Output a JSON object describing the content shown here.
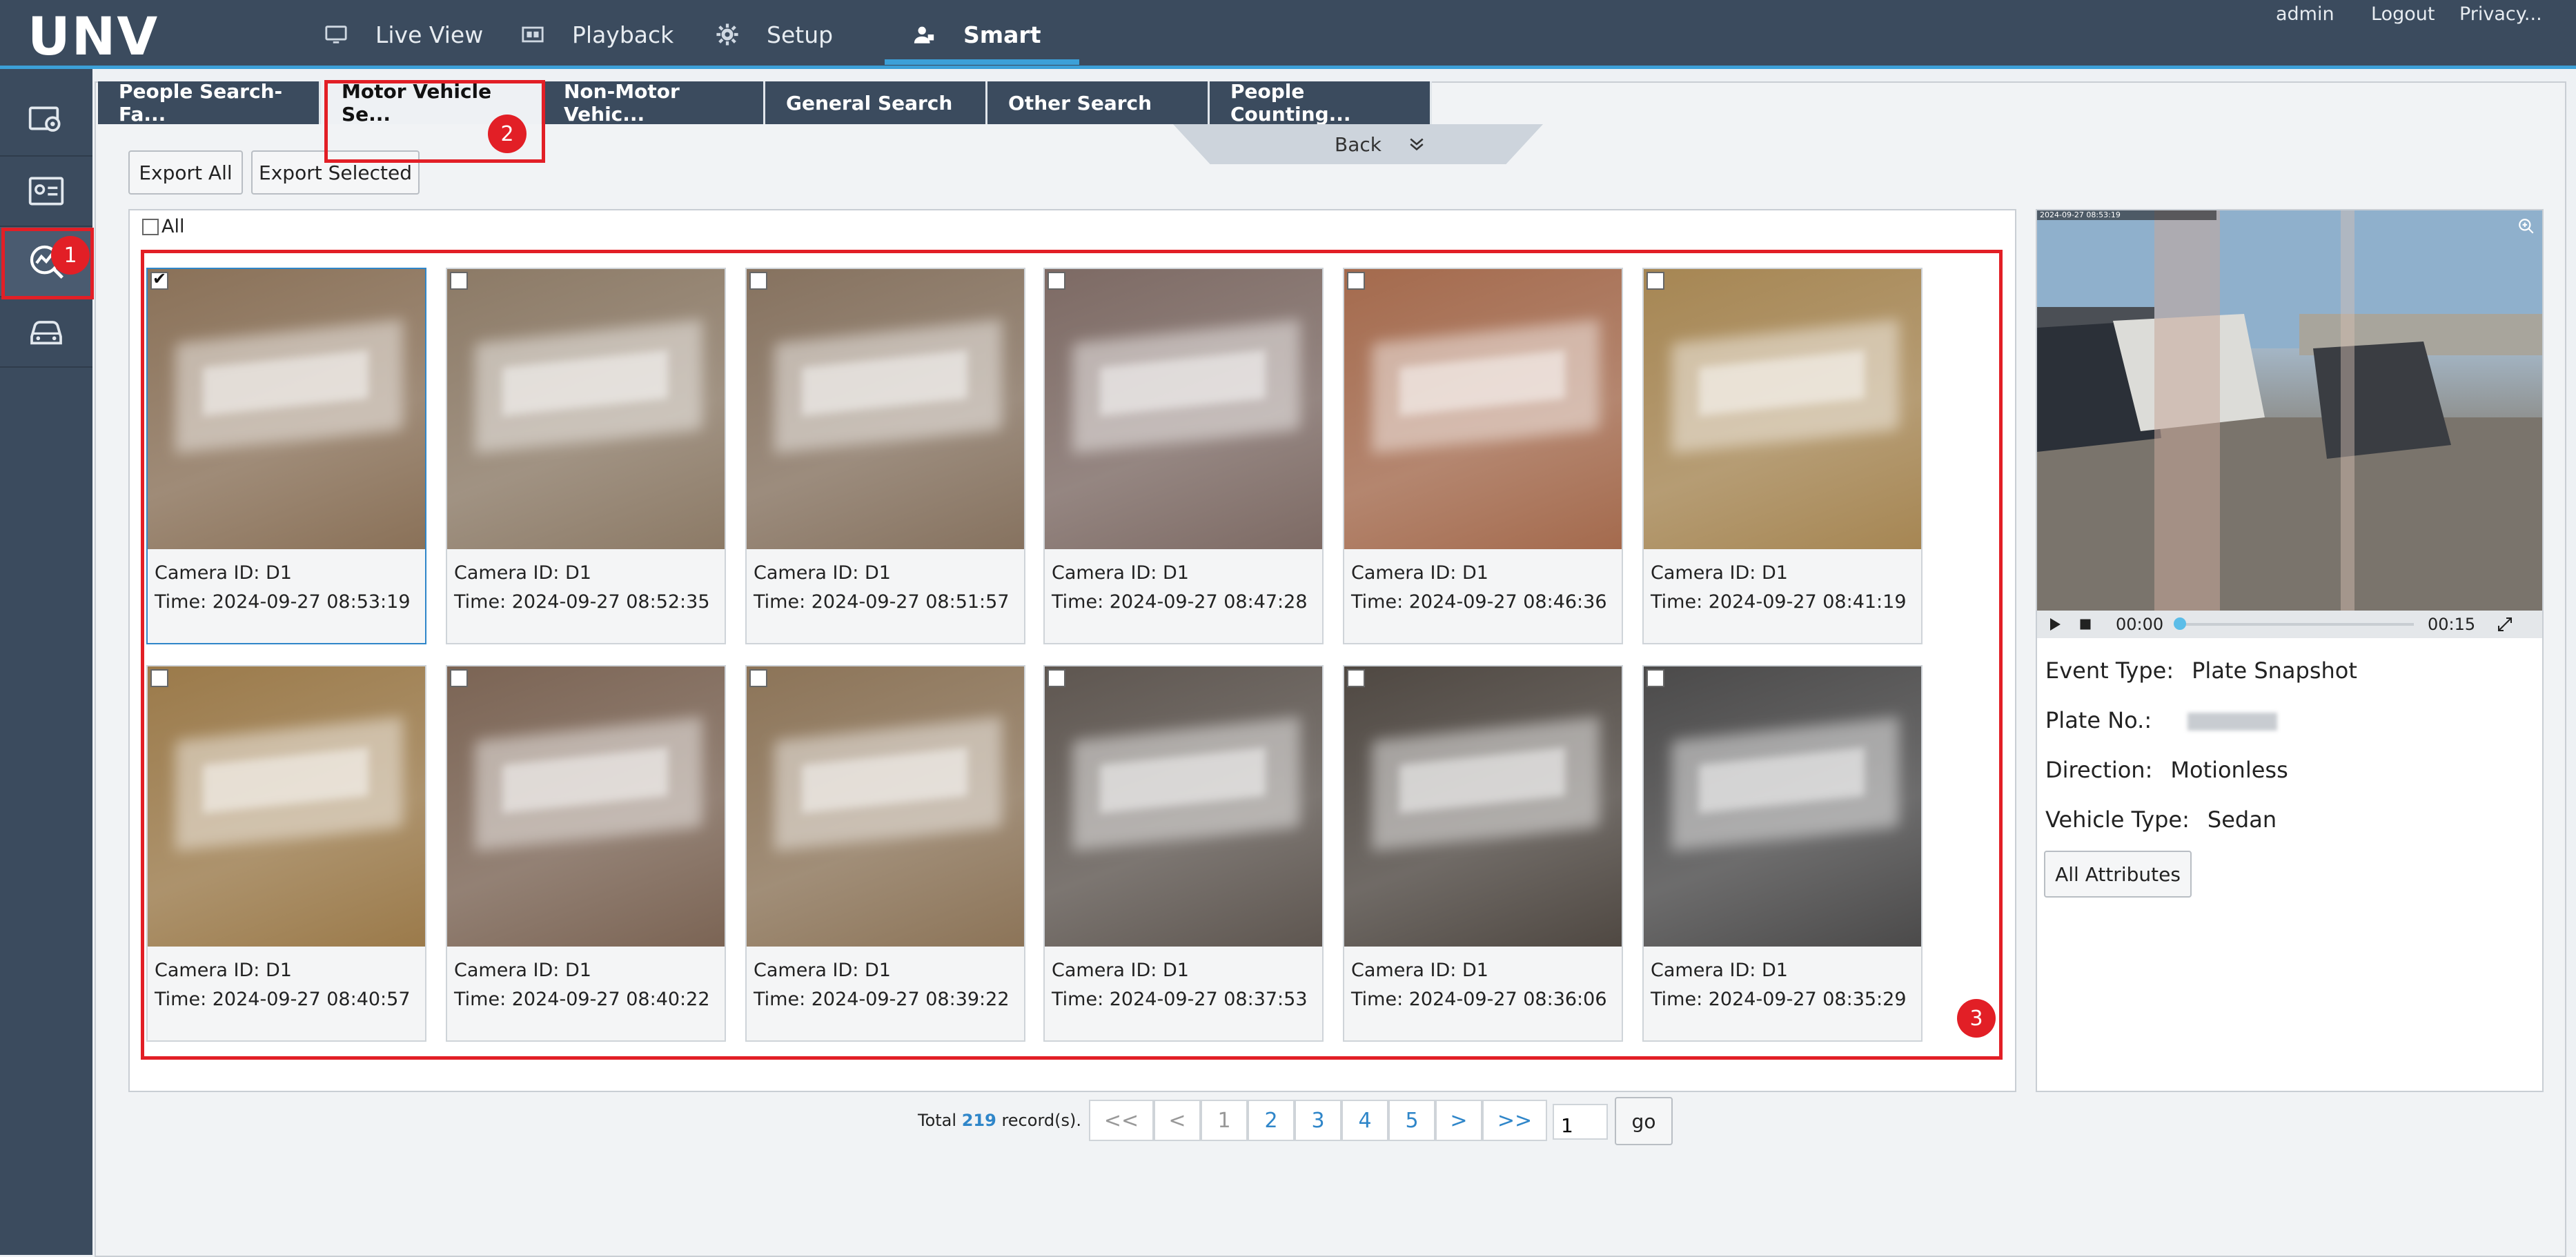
{
  "header": {
    "logo": "UNV",
    "nav": [
      {
        "label": "Live View",
        "icon": "monitor-icon"
      },
      {
        "label": "Playback",
        "icon": "film-icon"
      },
      {
        "label": "Setup",
        "icon": "gear-icon"
      },
      {
        "label": "Smart",
        "icon": "person-icon",
        "active": true
      }
    ],
    "user": "admin",
    "logout": "Logout",
    "privacy": "Privacy..."
  },
  "sidebar": {
    "items": [
      {
        "icon": "camera-settings-icon"
      },
      {
        "icon": "id-card-icon"
      },
      {
        "icon": "analytics-search-icon",
        "active": true
      },
      {
        "icon": "car-icon"
      }
    ]
  },
  "tabs": [
    {
      "label": "People Search-Fa..."
    },
    {
      "label": "Motor Vehicle Se...",
      "active": true
    },
    {
      "label": "Non-Motor Vehic..."
    },
    {
      "label": "General Search"
    },
    {
      "label": "Other Search"
    },
    {
      "label": "People Counting..."
    }
  ],
  "back_label": "Back",
  "toolbar": {
    "export_all": "Export All",
    "export_selected": "Export Selected"
  },
  "select_all_label": "All",
  "cards": [
    {
      "camera": "Camera ID: D1",
      "time": "Time: 2024-09-27 08:53:19",
      "checked": true,
      "color": "#8a7158"
    },
    {
      "camera": "Camera ID: D1",
      "time": "Time: 2024-09-27 08:52:35",
      "checked": false,
      "color": "#8c7a66"
    },
    {
      "camera": "Camera ID: D1",
      "time": "Time: 2024-09-27 08:51:57",
      "checked": false,
      "color": "#86725f"
    },
    {
      "camera": "Camera ID: D1",
      "time": "Time: 2024-09-27 08:47:28",
      "checked": false,
      "color": "#7d6a64"
    },
    {
      "camera": "Camera ID: D1",
      "time": "Time: 2024-09-27 08:46:36",
      "checked": false,
      "color": "#a46a4d"
    },
    {
      "camera": "Camera ID: D1",
      "time": "Time: 2024-09-27 08:41:19",
      "checked": false,
      "color": "#a68653"
    },
    {
      "camera": "Camera ID: D1",
      "time": "Time: 2024-09-27 08:40:57",
      "checked": false,
      "color": "#9b7a4a"
    },
    {
      "camera": "Camera ID: D1",
      "time": "Time: 2024-09-27 08:40:22",
      "checked": false,
      "color": "#7b6454"
    },
    {
      "camera": "Camera ID: D1",
      "time": "Time: 2024-09-27 08:39:22",
      "checked": false,
      "color": "#8c7458"
    },
    {
      "camera": "Camera ID: D1",
      "time": "Time: 2024-09-27 08:37:53",
      "checked": false,
      "color": "#5e5650"
    },
    {
      "camera": "Camera ID: D1",
      "time": "Time: 2024-09-27 08:36:06",
      "checked": false,
      "color": "#4f4842"
    },
    {
      "camera": "Camera ID: D1",
      "time": "Time: 2024-09-27 08:35:29",
      "checked": false,
      "color": "#4b4a4a"
    }
  ],
  "preview": {
    "timestamp": "2024-09-27 08:53:19",
    "time_start": "00:00",
    "time_end": "00:15",
    "attributes": [
      {
        "label": "Event Type:",
        "value": "Plate Snapshot"
      },
      {
        "label": "Plate No.:",
        "value": ""
      },
      {
        "label": "Direction:",
        "value": "Motionless"
      },
      {
        "label": "Vehicle Type:",
        "value": "Sedan"
      }
    ],
    "all_attributes_button": "All Attributes"
  },
  "pagination": {
    "total_prefix": "Total",
    "total": "219",
    "total_suffix": "record(s).",
    "first": "<<",
    "prev": "<",
    "pages": [
      "1",
      "2",
      "3",
      "4",
      "5"
    ],
    "next": ">",
    "last": ">>",
    "jump_value": "1",
    "go": "go"
  },
  "annotations": [
    "1",
    "2",
    "3"
  ],
  "colors": {
    "bar": "#3b4b5e",
    "accent": "#3ca0d8",
    "marker": "#e21f26",
    "link": "#2f86c9"
  }
}
